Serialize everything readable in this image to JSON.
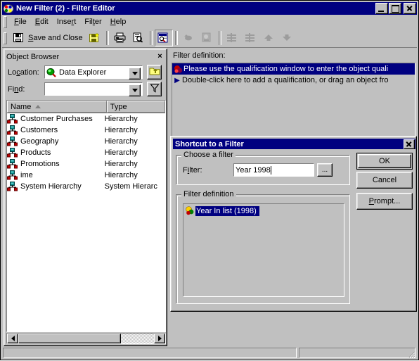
{
  "window": {
    "title": "New Filter (2) - Filter Editor",
    "icon": "palette-icon",
    "minimize_label": "Minimize",
    "maximize_label": "Maximize",
    "close_label": "Close"
  },
  "menubar": {
    "items": [
      {
        "label": "File",
        "accel": "F"
      },
      {
        "label": "Edit",
        "accel": "E"
      },
      {
        "label": "Insert",
        "accel": "r"
      },
      {
        "label": "Filter",
        "accel": "t"
      },
      {
        "label": "Help",
        "accel": "H"
      }
    ]
  },
  "toolbar": {
    "save_and_close_label": "Save and Close",
    "save_and_close_accel": "S",
    "buttons": [
      {
        "name": "save-and-close-button",
        "icon": "floppy-disk-icon",
        "enabled": true
      },
      {
        "name": "save-as-button",
        "icon": "floppy-disk-star-icon",
        "enabled": true
      },
      {
        "name": "print-button",
        "icon": "printer-icon",
        "enabled": true
      },
      {
        "name": "print-preview-button",
        "icon": "magnifier-page-icon",
        "enabled": true
      },
      {
        "name": "object-browser-toggle-button",
        "icon": "object-browser-icon",
        "enabled": true,
        "pressed": true
      },
      {
        "name": "insert-object-button",
        "icon": "cloud-icon",
        "enabled": false
      },
      {
        "name": "insert-prompt-button",
        "icon": "prompt-icon",
        "enabled": false
      },
      {
        "name": "align-one-button",
        "icon": "align-icon",
        "enabled": false
      },
      {
        "name": "align-two-button",
        "icon": "align-icon",
        "enabled": false
      },
      {
        "name": "move-up-button",
        "icon": "arrow-up-icon",
        "enabled": false
      },
      {
        "name": "move-down-button",
        "icon": "arrow-down-icon",
        "enabled": false
      }
    ]
  },
  "object_browser": {
    "title": "Object Browser",
    "close_label": "×",
    "location_label": "Location:",
    "location_accel": "c",
    "location_value": "Data Explorer",
    "location_icon": "data-explorer-icon",
    "up_button_icon": "up-folder-icon",
    "find_label": "Find:",
    "find_accel": "n",
    "find_value": "",
    "filter_button_icon": "funnel-icon",
    "columns": [
      "Name",
      "Type"
    ],
    "sort_column": "Name",
    "sort_direction": "ascending",
    "rows": [
      {
        "name": "Customer Purchases",
        "type": "Hierarchy",
        "icon": "hierarchy-icon"
      },
      {
        "name": "Customers",
        "type": "Hierarchy",
        "icon": "hierarchy-icon"
      },
      {
        "name": "Geography",
        "type": "Hierarchy",
        "icon": "hierarchy-icon"
      },
      {
        "name": "Products",
        "type": "Hierarchy",
        "icon": "hierarchy-icon"
      },
      {
        "name": "Promotions",
        "type": "Hierarchy",
        "icon": "hierarchy-icon"
      },
      {
        "name": "ime",
        "type": "Hierarchy",
        "icon": "hierarchy-icon"
      },
      {
        "name": "System Hierarchy",
        "type": "System Hierarc",
        "icon": "hierarchy-icon"
      }
    ]
  },
  "filter_definition_pane": {
    "label": "Filter definition:",
    "selected_row": {
      "text": "Please use the qualification window to enter the object quali",
      "icon": "filter-object-icon"
    },
    "hint_row": {
      "text": "Double-click here to add a qualification, or drag an object fro",
      "icon": "blue-arrow-bullet"
    }
  },
  "dialog": {
    "title": "Shortcut to a Filter",
    "close_label": "×",
    "choose_group_caption": "Choose a filter",
    "filter_label": "Filter:",
    "filter_accel": "i",
    "filter_value": "Year 1998",
    "browse_button_label": "...",
    "definition_group_caption": "Filter definition",
    "definition_item": {
      "text": "Year In list (1998)",
      "icon": "filter-object-icon",
      "selected": true
    },
    "buttons": [
      {
        "name": "ok-button",
        "label": "OK",
        "default": true
      },
      {
        "name": "cancel-button",
        "label": "Cancel",
        "default": false
      },
      {
        "name": "prompt-button",
        "label": "Prompt...",
        "accel": "P",
        "default": false
      }
    ]
  },
  "statusbar": {
    "left_text": "",
    "right_text": ""
  },
  "colors": {
    "titlebar": "#000080",
    "face": "#c0c0c0",
    "selection": "#000080",
    "selection_text": "#ffffff",
    "window": "#ffffff"
  }
}
